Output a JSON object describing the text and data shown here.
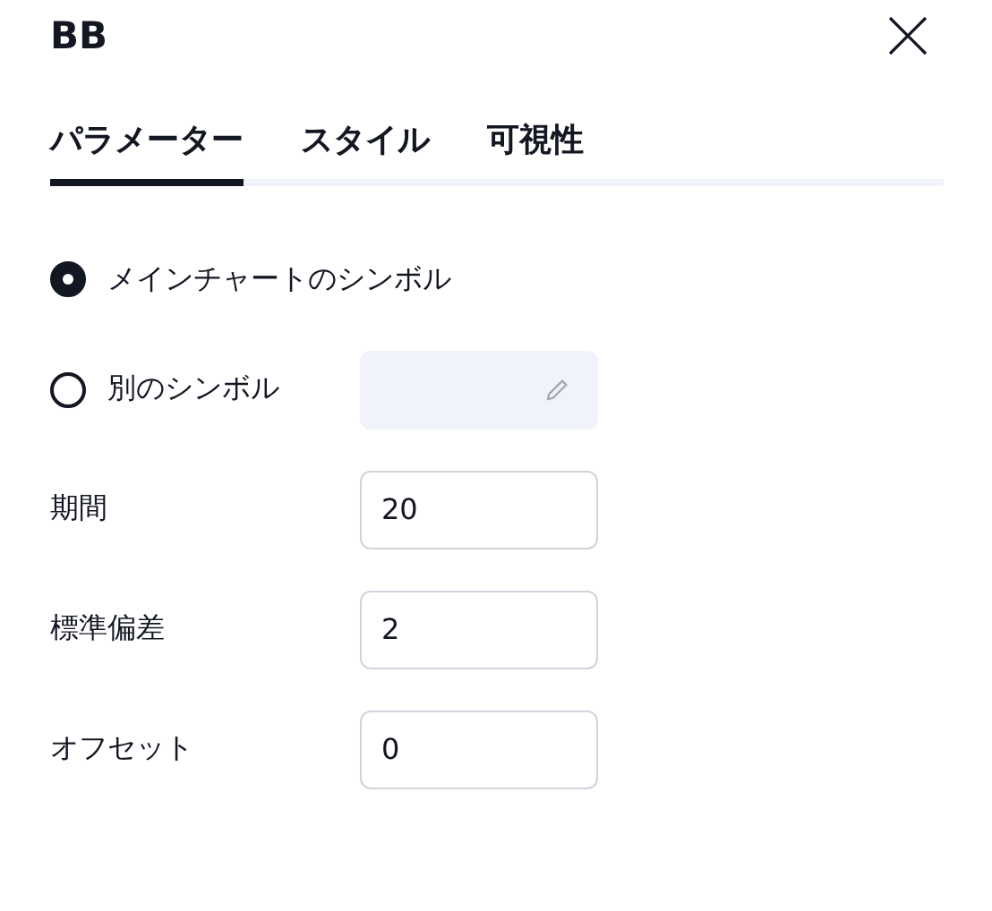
{
  "header": {
    "title": "BB"
  },
  "tabs": [
    {
      "label": "パラメーター",
      "selected": true
    },
    {
      "label": "スタイル",
      "selected": false
    },
    {
      "label": "可視性",
      "selected": false
    }
  ],
  "symbol_options": [
    {
      "label": "メインチャートのシンボル",
      "selected": true
    },
    {
      "label": "別のシンボル",
      "selected": false,
      "field": {
        "disabled": true
      }
    }
  ],
  "inputs": [
    {
      "label": "期間",
      "value": "20"
    },
    {
      "label": "標準偏差",
      "value": "2"
    },
    {
      "label": "オフセット",
      "value": "0"
    }
  ]
}
